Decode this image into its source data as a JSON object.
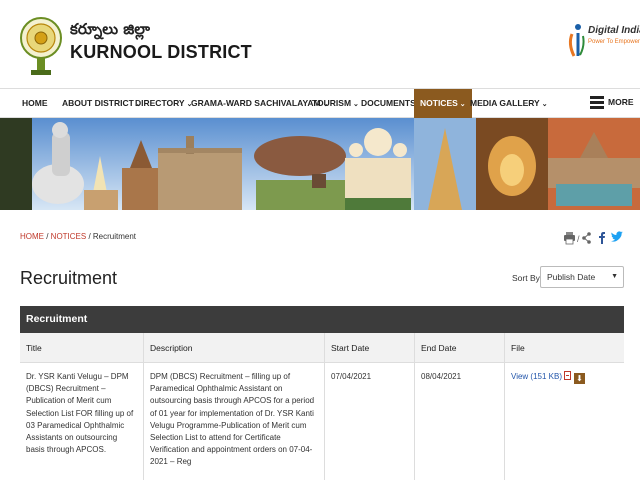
{
  "header": {
    "title_telugu": "కర్నూలు జిల్లా",
    "title_english": "KURNOOL DISTRICT",
    "digital_india": {
      "title": "Digital India",
      "tagline": "Power To Empower"
    }
  },
  "nav": {
    "items": [
      {
        "label": "HOME",
        "dropdown": false
      },
      {
        "label": "ABOUT DISTRICT",
        "dropdown": true
      },
      {
        "label": "DIRECTORY",
        "dropdown": true
      },
      {
        "label": "GRAMA-WARD SACHIVALAYAM",
        "dropdown": true
      },
      {
        "label": "TOURISM",
        "dropdown": true
      },
      {
        "label": "DOCUMENTS",
        "dropdown": true
      },
      {
        "label": "NOTICES",
        "dropdown": true,
        "active": true
      },
      {
        "label": "MEDIA GALLERY",
        "dropdown": true
      }
    ],
    "caret": "⌄",
    "more_label": "MORE",
    "active_color": "#8b5a1f"
  },
  "breadcrumb": {
    "home": "HOME",
    "sep1": " / ",
    "notices": "NOTICES",
    "sep2": " / ",
    "current": "Recruitment"
  },
  "page": {
    "title": "Recruitment",
    "sort_label": "Sort By:",
    "sort_value": "Publish Date",
    "sort_arrow": "▼"
  },
  "table": {
    "header": "Recruitment",
    "columns": [
      "Title",
      "Description",
      "Start Date",
      "End Date",
      "File"
    ],
    "rows": [
      {
        "title": "Dr. YSR Kanti Velugu – DPM (DBCS) Recruitment – Publication of Merit cum Selection List FOR filling up of 03 Paramedical Ophthalmic Assistants on outsourcing basis through APCOS.",
        "description": "DPM (DBCS) Recruitment – filling up of Paramedical Ophthalmic Assistant on outsourcing basis through APCOS for a period of 01 year for implementation of Dr. YSR Kanti Velugu Programme-Publication of Merit cum Selection List to attend for Certificate Verification and appointment orders on 07-04-2021 – Reg",
        "start_date": "07/04/2021",
        "end_date": "08/04/2021",
        "file_label": "View (151 KB)",
        "download_glyph": "⬇"
      }
    ]
  },
  "icons": {
    "emblem": "ap-state-emblem-icon",
    "print": "print-icon",
    "share": "share-icon",
    "facebook": "facebook-icon",
    "twitter": "twitter-icon"
  },
  "colors": {
    "accent": "#8b5a1f",
    "table_header": "#3c3c3c",
    "breadcrumb_link": "#c0392b",
    "link": "#2255aa"
  }
}
